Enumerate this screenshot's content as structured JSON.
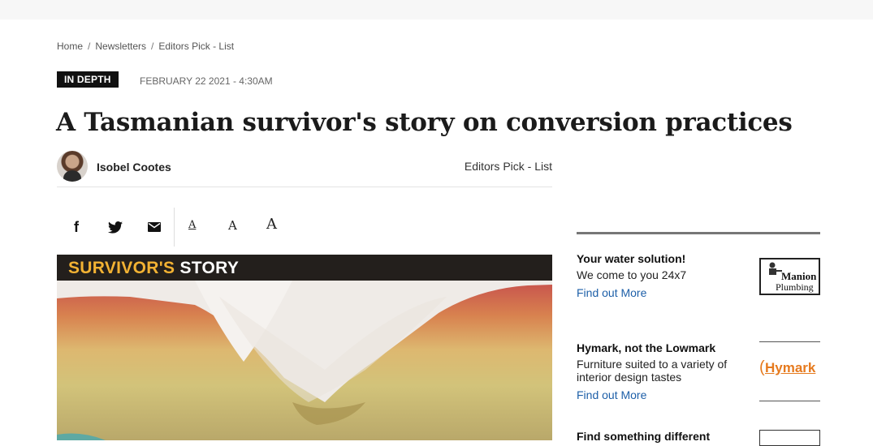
{
  "breadcrumb": {
    "home": "Home",
    "newsletters": "Newsletters",
    "current": "Editors Pick - List",
    "sep": "/"
  },
  "article": {
    "badge": "IN DEPTH",
    "date": "FEBRUARY 22 2021 - 4:30AM",
    "title": "A Tasmanian survivor's story on conversion practices",
    "author": "Isobel Cootes",
    "section": "Editors Pick - List"
  },
  "share": {
    "facebook_icon": "f",
    "font_small": "A",
    "font_medium": "A",
    "font_large": "A"
  },
  "hero": {
    "title_part1": "SURVIVOR'S",
    "title_part2": " STORY"
  },
  "ads": [
    {
      "title": "Your water solution!",
      "desc": "We come to you 24x7",
      "link": "Find out More",
      "logo_line1": "Manion",
      "logo_line2": "Plumbing"
    },
    {
      "title": "Hymark, not the Lowmark",
      "desc": "Furniture suited to a variety of interior design tastes",
      "link": "Find out More",
      "logo_text": "Hymark"
    },
    {
      "title": "Find something different"
    }
  ],
  "colors": {
    "link": "#1d5fa8",
    "badge_bg": "#111111",
    "hero_accent": "#f2b233"
  }
}
